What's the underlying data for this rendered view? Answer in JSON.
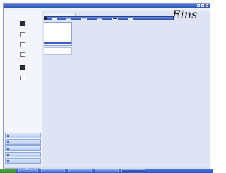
{
  "overlay_text": "Eins",
  "colors": {
    "title_bar": "#2d56b8",
    "selection": "#3b5fc4",
    "workspace": "#dfe4f4",
    "taskbar": "#2754c4",
    "start_button": "#2c8a27"
  }
}
